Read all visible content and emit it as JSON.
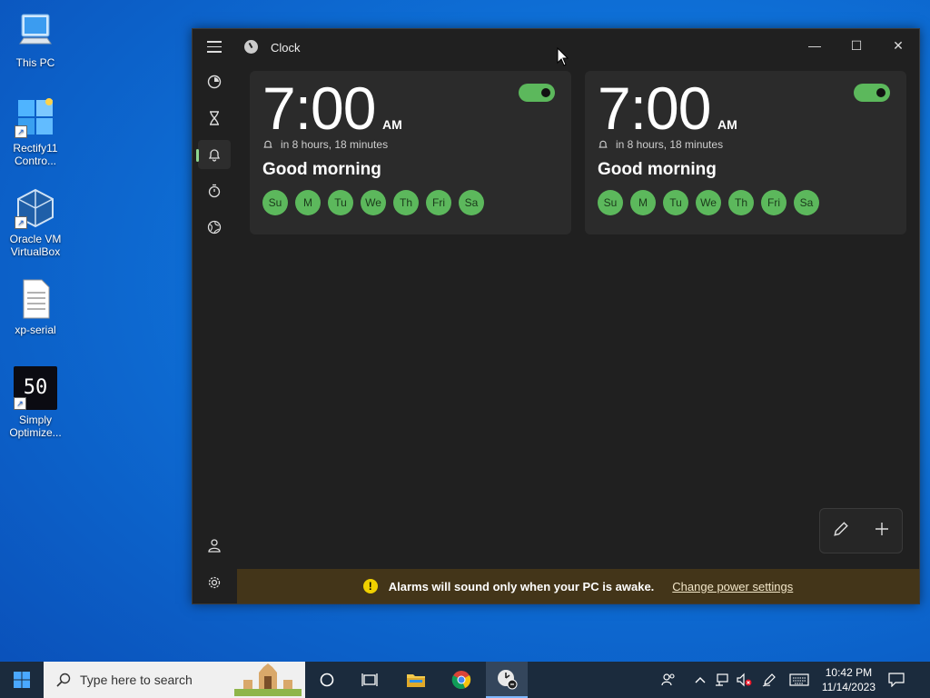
{
  "desktop": {
    "icons": [
      {
        "label": "This PC"
      },
      {
        "label": "Rectify11 Contro..."
      },
      {
        "label": "Oracle VM VirtualBox"
      },
      {
        "label": "xp-serial"
      },
      {
        "label": "Simply Optimize..."
      }
    ],
    "simply_icon_text": "50"
  },
  "window": {
    "title": "Clock",
    "minimize": "—",
    "maximize": "☐",
    "close": "✕"
  },
  "alarms": [
    {
      "time": "7:00",
      "ampm": "AM",
      "remaining": "in 8 hours, 18 minutes",
      "name": "Good morning",
      "days": [
        "Su",
        "M",
        "Tu",
        "We",
        "Th",
        "Fri",
        "Sa"
      ]
    },
    {
      "time": "7:00",
      "ampm": "AM",
      "remaining": "in 8 hours, 18 minutes",
      "name": "Good morning",
      "days": [
        "Su",
        "M",
        "Tu",
        "We",
        "Th",
        "Fri",
        "Sa"
      ]
    }
  ],
  "infobar": {
    "icon": "!",
    "message": "Alarms will sound only when your PC is awake.",
    "link": "Change power settings"
  },
  "taskbar": {
    "search_placeholder": "Type here to search",
    "time": "10:42 PM",
    "date": "11/14/2023"
  },
  "colors": {
    "accent_green": "#5cb85c",
    "window_bg": "#202020",
    "card_bg": "#2b2b2b",
    "infobar_bg": "#433519"
  }
}
